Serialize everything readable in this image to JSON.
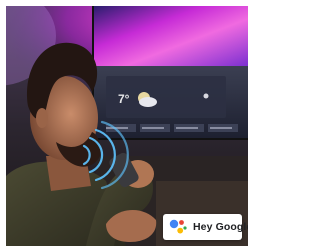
{
  "tv_screen": {
    "temperature": "7°"
  },
  "badge": {
    "label": "Hey Google",
    "icon": "google-assistant-icon",
    "dot_colors": [
      "#4285F4",
      "#EA4335",
      "#FBBC05",
      "#34A853"
    ]
  },
  "colors": {
    "ambilight_magenta": "#c21fd6",
    "ambilight_blue": "#3a47c8",
    "wall": "#3b2f3c"
  }
}
